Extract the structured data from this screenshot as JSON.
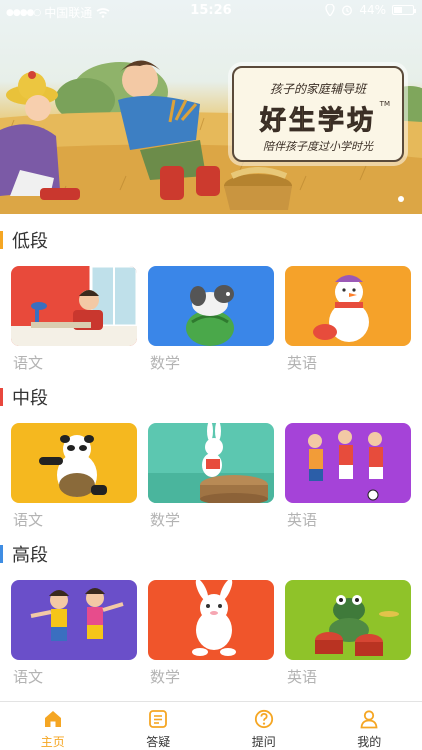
{
  "status_bar": {
    "carrier": "中国联通",
    "time": "15:26",
    "battery": "44%",
    "battery_level": 0.44
  },
  "banner": {
    "line1": "孩子的家庭辅导班",
    "brand": "好生学坊",
    "trademark": "TM",
    "line3": "陪伴孩子度过小学时光"
  },
  "sections": [
    {
      "title": "低段",
      "accent": "#f5a623",
      "cards": [
        {
          "label": "语文"
        },
        {
          "label": "数学"
        },
        {
          "label": "英语"
        }
      ]
    },
    {
      "title": "中段",
      "accent": "#e8473d",
      "cards": [
        {
          "label": "语文"
        },
        {
          "label": "数学"
        },
        {
          "label": "英语"
        }
      ]
    },
    {
      "title": "高段",
      "accent": "#3f8de3",
      "cards": [
        {
          "label": "语文"
        },
        {
          "label": "数学"
        },
        {
          "label": "英语"
        }
      ]
    }
  ],
  "tabbar": {
    "accent": "#f5a623",
    "items": [
      {
        "label": "主页",
        "icon": "home-icon",
        "active": true
      },
      {
        "label": "答疑",
        "icon": "message-icon",
        "active": false
      },
      {
        "label": "提问",
        "icon": "question-icon",
        "active": false
      },
      {
        "label": "我的",
        "icon": "user-icon",
        "active": false
      }
    ]
  }
}
